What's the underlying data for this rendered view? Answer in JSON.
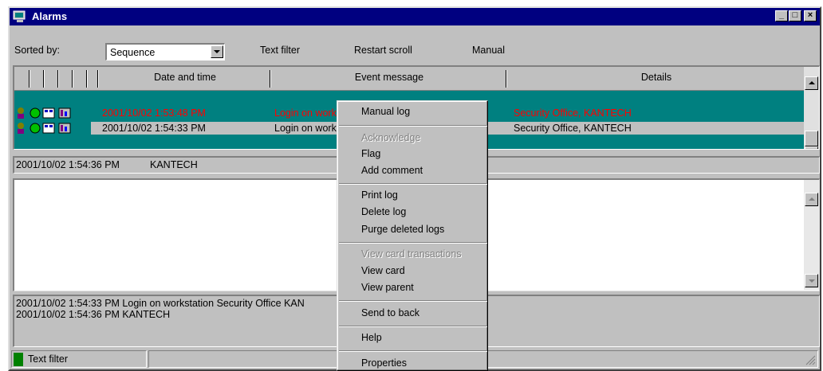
{
  "window": {
    "title": "Alarms",
    "controls": {
      "minimize": "_",
      "maximize": "□",
      "close": "×"
    }
  },
  "toolbar": {
    "sorted_by_label": "Sorted by:",
    "sort_value": "Sequence",
    "text_filter_label": "Text filter",
    "restart_scroll_label": "Restart scroll",
    "manual_label": "Manual"
  },
  "list": {
    "columns": {
      "date_time": "Date and time",
      "event_message": "Event message",
      "details": "Details"
    },
    "rows": [
      {
        "date_time": "2001/10/02 1:53:48 PM",
        "event_message": "Login on work",
        "details": "Security Office, KANTECH"
      },
      {
        "date_time": "2001/10/02 1:54:33 PM",
        "event_message": "Login on work",
        "details": "Security Office, KANTECH"
      }
    ]
  },
  "info_bar": {
    "date_time": "2001/10/02 1:54:36 PM",
    "user": "KANTECH"
  },
  "log_panel": {
    "lines": [
      "2001/10/02 1:54:33 PM  Login on workstation  Security Office  KAN",
      "2001/10/02 1:54:36 PM    KANTECH"
    ]
  },
  "status_bar": {
    "text_filter": "Text filter"
  },
  "context_menu": {
    "items": [
      {
        "label": "Manual log",
        "enabled": true
      },
      {
        "label": "Acknowledge",
        "enabled": false
      },
      {
        "label": "Flag",
        "enabled": true
      },
      {
        "label": "Add comment",
        "enabled": true
      },
      {
        "label": "Print log",
        "enabled": true
      },
      {
        "label": "Delete log",
        "enabled": true
      },
      {
        "label": "Purge deleted logs",
        "enabled": true
      },
      {
        "label": "View card transactions",
        "enabled": false
      },
      {
        "label": "View card",
        "enabled": true
      },
      {
        "label": "View parent",
        "enabled": true
      },
      {
        "label": "Send to back",
        "enabled": true
      },
      {
        "label": "Help",
        "enabled": true
      },
      {
        "label": "Properties",
        "enabled": true
      }
    ]
  },
  "colors": {
    "titlebar": "#000080",
    "list_background": "#008080",
    "alarm_text": "#ff0000",
    "status_green": "#008000"
  }
}
